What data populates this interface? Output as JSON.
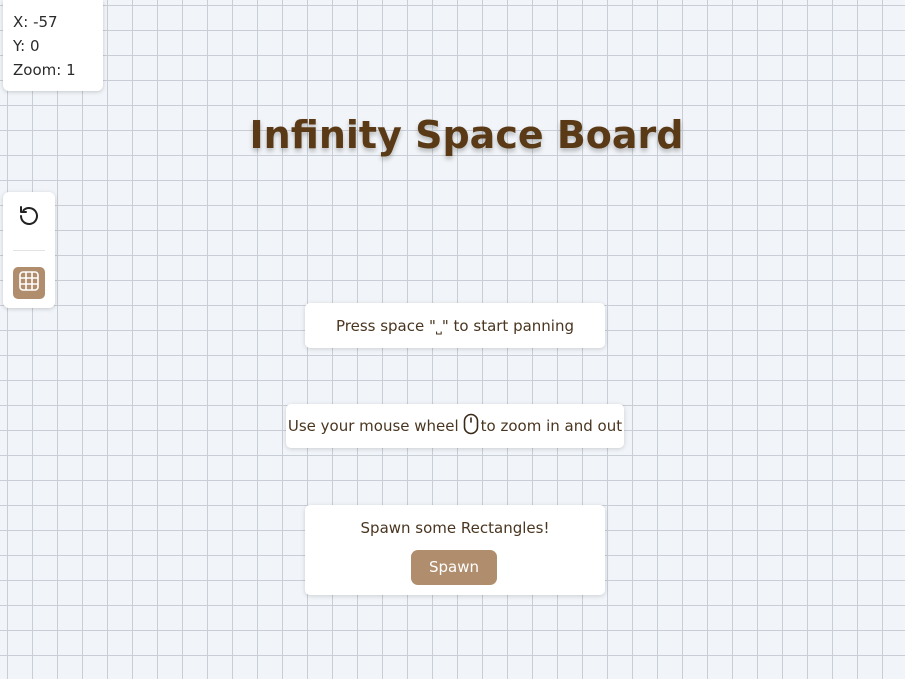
{
  "status": {
    "x_label": "X: -57",
    "y_label": "Y: 0",
    "zoom_label": "Zoom: 1"
  },
  "toolbar": {
    "reset_icon": "reset-rotate-icon",
    "grid_icon": "grid-icon"
  },
  "title": "Infinity Space Board",
  "instructions": {
    "pan_text": "Press space \"⎵\" to start panning",
    "zoom_before": "Use your mouse wheel",
    "zoom_after": "to zoom in and out",
    "zoom_icon": "mouse-icon"
  },
  "spawn": {
    "text": "Spawn some Rectangles!",
    "button_label": "Spawn"
  },
  "colors": {
    "accent": "#b08d6c",
    "title": "#5a3a16",
    "background": "#f1f4f8",
    "grid_line": "#c9ced6"
  }
}
